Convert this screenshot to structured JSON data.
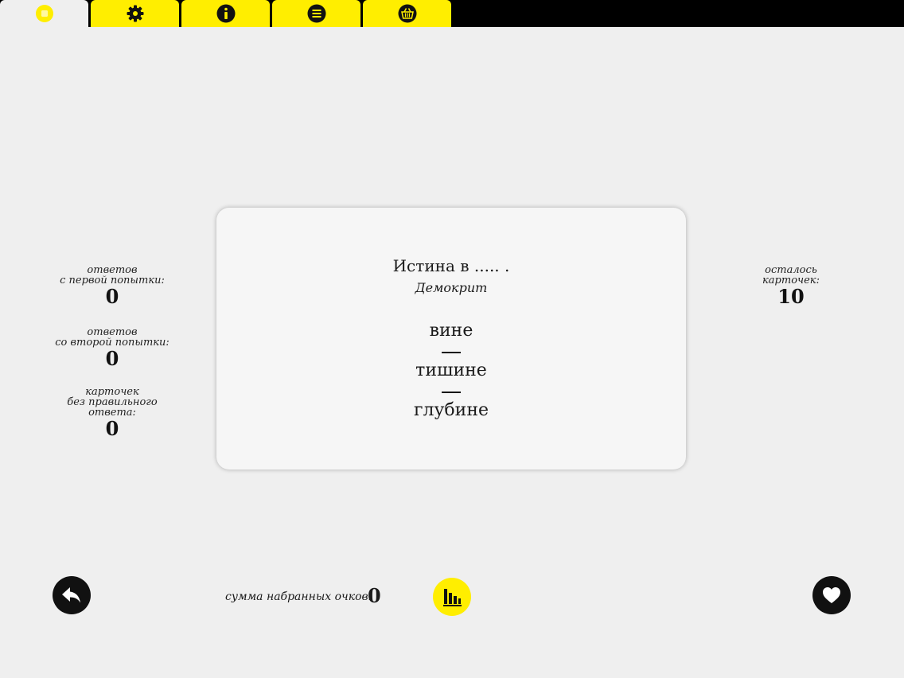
{
  "tabs": [
    {
      "icon": "card-icon",
      "active": true
    },
    {
      "icon": "gear-icon"
    },
    {
      "icon": "info-icon"
    },
    {
      "icon": "list-icon"
    },
    {
      "icon": "basket-icon"
    }
  ],
  "stats": {
    "first_try": {
      "label_line1": "ответов",
      "label_line2": "с первой попытки:",
      "value": "0"
    },
    "second_try": {
      "label_line1": "ответов",
      "label_line2": "со второй попытки:",
      "value": "0"
    },
    "no_answer": {
      "label_line1": "карточек",
      "label_line2": "без правильного",
      "label_line3": "ответа:",
      "value": "0"
    },
    "remaining": {
      "label_line1": "осталось",
      "label_line2": "карточек:",
      "value": "10"
    }
  },
  "card": {
    "quote": "Истина в ..... .",
    "author": "Демокрит",
    "options": [
      "вине",
      "тишине",
      "глубине"
    ]
  },
  "footer": {
    "score_label": "сумма набранных очков:",
    "score_value": "0",
    "back_icon": "back-arrow-icon",
    "stats_icon": "bar-chart-icon",
    "favorite_icon": "heart-icon"
  },
  "colors": {
    "accent": "#ffee00",
    "topbar": "#000000",
    "background": "#efefef"
  }
}
